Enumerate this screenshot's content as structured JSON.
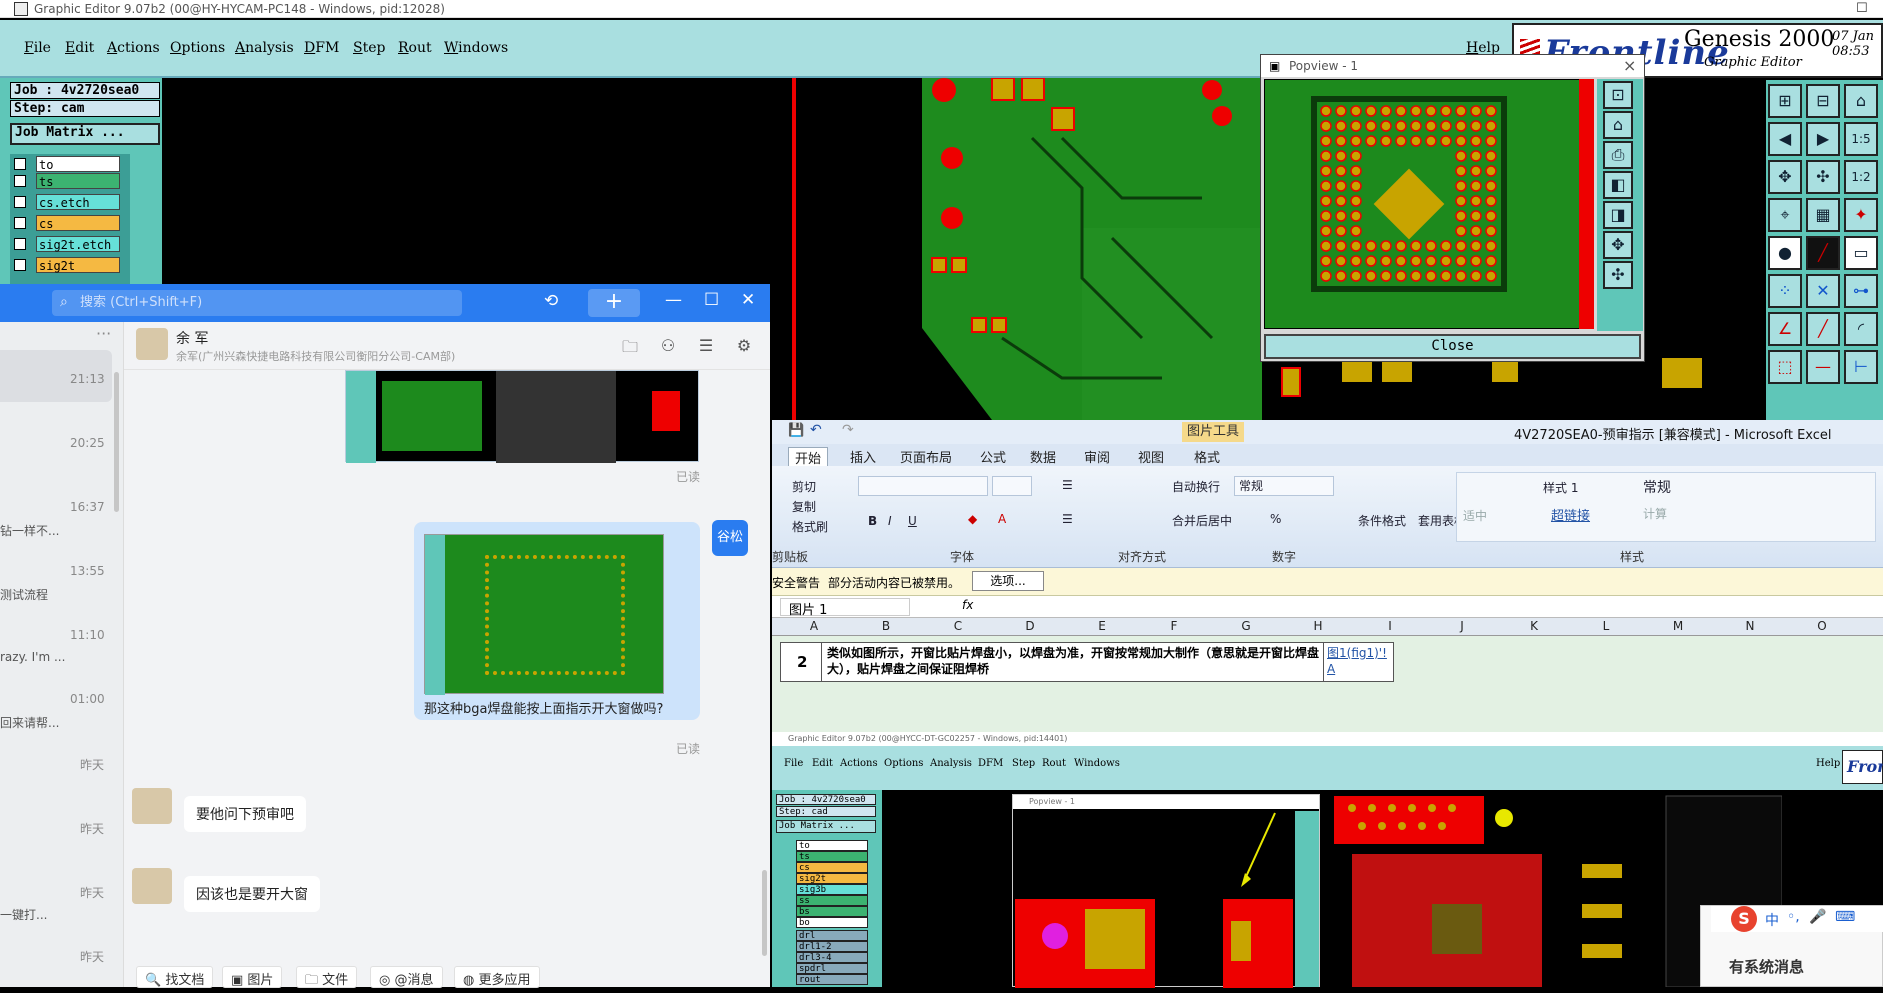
{
  "genesis": {
    "window_title": "Graphic Editor 9.07b2 (00@HY-HYCAM-PC148 - Windows, pid:12028)",
    "menu": [
      "File",
      "Edit",
      "Actions",
      "Options",
      "Analysis",
      "DFM",
      "Step",
      "Rout",
      "Windows"
    ],
    "help": "Help",
    "brand": {
      "logo": "Frontline",
      "product": "Genesis 2000",
      "subtitle": "Graphic Editor",
      "date": "07 Jan",
      "time": "08:53"
    },
    "job": "Job : 4v2720sea0",
    "step": "Step: cam",
    "job_matrix": "Job Matrix ...",
    "layers": [
      {
        "name": "to",
        "color": "#ffffff"
      },
      {
        "name": "ts",
        "color": "#3cb371"
      },
      {
        "name": "cs.etch",
        "color": "#66e0d8"
      },
      {
        "name": "cs",
        "color": "#f5b942"
      },
      {
        "name": "sig2t.etch",
        "color": "#66e0d8"
      },
      {
        "name": "sig2t",
        "color": "#f5b942"
      }
    ],
    "popview": {
      "title": "Popview - 1",
      "close_label": "Close"
    }
  },
  "chat": {
    "search_placeholder": "搜索 (Ctrl+Shift+F)",
    "contact_name": "余 军",
    "contact_org": "余军(广州兴森快捷电路科技有限公司衡阳分公司-CAM部)",
    "list": [
      {
        "time": "21:13",
        "snippet": ""
      },
      {
        "time": "20:25",
        "snippet": ""
      },
      {
        "time": "16:37",
        "snippet": "钻一样不..."
      },
      {
        "time": "13:55",
        "snippet": "测试流程"
      },
      {
        "time": "11:10",
        "snippet": "razy. I'm ..."
      },
      {
        "time": "01:00",
        "snippet": "回来请帮..."
      },
      {
        "time": "昨天",
        "snippet": ""
      },
      {
        "time": "昨天",
        "snippet": ""
      },
      {
        "time": "昨天",
        "snippet": "一键打..."
      },
      {
        "time": "昨天",
        "snippet": ""
      }
    ],
    "messages": [
      {
        "read": "已读"
      },
      {
        "sender_avatar": "谷松",
        "text": "那这种bga焊盘能按上面指示开大窗做吗?",
        "read": "已读"
      },
      {
        "text": "要他问下预审吧"
      },
      {
        "text": "因该也是要开大窗"
      }
    ],
    "toolbar": [
      "找文档",
      "图片",
      "文件",
      "@消息",
      "更多应用"
    ]
  },
  "excel": {
    "title": "4V2720SEA0-预审指示  [兼容模式] - Microsoft Excel",
    "picture_tools": "图片工具",
    "tabs": [
      "开始",
      "插入",
      "页面布局",
      "公式",
      "数据",
      "审阅",
      "视图",
      "格式"
    ],
    "clipboard": {
      "cut": "剪切",
      "copy": "复制",
      "format_painter": "格式刷",
      "group": "剪贴板"
    },
    "font_group": "字体",
    "align": {
      "wrap": "自动换行",
      "merge": "合并后居中",
      "group": "对齐方式"
    },
    "number": {
      "format": "常规",
      "group": "数字"
    },
    "styles": {
      "cond": "条件格式",
      "table": "套用表格格式",
      "style1": "样式 1",
      "normal": "常规",
      "neutral": "适中",
      "hyperlink": "超链接",
      "calc": "计算",
      "group": "样式"
    },
    "security": {
      "label": "安全警告",
      "msg": "部分活动内容已被禁用。",
      "options": "选项..."
    },
    "namebox": "图片 1",
    "fx": "fx",
    "columns": [
      "A",
      "B",
      "C",
      "D",
      "E",
      "F",
      "G",
      "H",
      "I",
      "J",
      "K",
      "L",
      "M",
      "N",
      "O"
    ],
    "row_num": "2",
    "row_text": "类似如图所示，开窗比贴片焊盘小，以焊盘为准，开窗按常规加大制作（意思就是开窗比焊盘大），贴片焊盘之间保证阻焊桥",
    "row_link": "图1(fig1)'!A"
  },
  "genesis2": {
    "title": "Graphic Editor 9.07b2 (00@HYCC-DT-GC02257 - Windows, pid:14401)",
    "menu": [
      "File",
      "Edit",
      "Actions",
      "Options",
      "Analysis",
      "DFM",
      "Step",
      "Rout",
      "Windows"
    ],
    "help": "Help",
    "logo": "Fron",
    "job": "Job : 4v2720sea0",
    "step": "Step: cad",
    "job_matrix": "Job Matrix ...",
    "popview_title": "Popview - 1",
    "layers": [
      "to",
      "ts",
      "cs",
      "sig2t",
      "sig3b",
      "ss",
      "bs",
      "bo",
      "drl",
      "drl1-2",
      "drl3-4",
      "spdrl",
      "rout"
    ]
  },
  "ime": {
    "message": "有系统消息",
    "lang": "中"
  }
}
